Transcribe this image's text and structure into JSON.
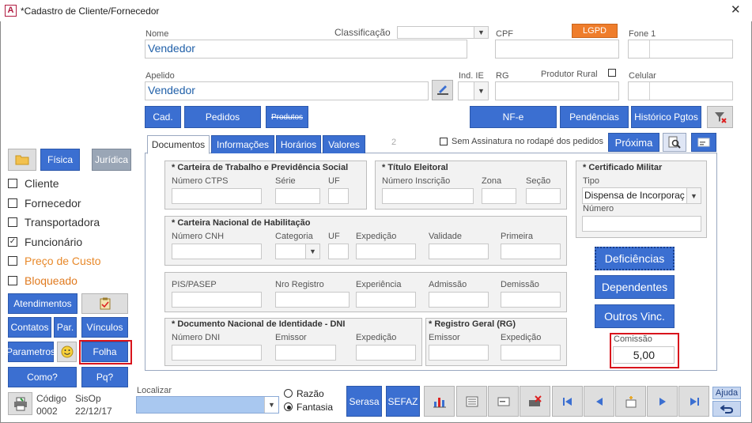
{
  "window": {
    "title": "*Cadastro de Cliente/Fornecedor",
    "app_letter": "A",
    "close": "✕"
  },
  "form": {
    "nome_label": "Nome",
    "nome_value": "Vendedor",
    "classificacao_label": "Classificação",
    "cpf_label": "CPF",
    "lgpd": "LGPD",
    "fone1_label": "Fone 1",
    "apelido_label": "Apelido",
    "apelido_value": "Vendedor",
    "ind_ie_label": "Ind. IE",
    "rg_label": "RG",
    "produtor_rural_label": "Produtor Rural",
    "celular_label": "Celular"
  },
  "action_buttons": {
    "cad": "Cad.",
    "pedidos": "Pedidos",
    "produtos": "Produtos",
    "nfe": "NF-e",
    "pendencias": "Pendências",
    "historico": "Histórico Pgtos"
  },
  "tabs": {
    "items": [
      "Documentos",
      "Informações",
      "Horários",
      "Valores"
    ],
    "counter": "2",
    "sem_assinatura": "Sem Assinatura no rodapé dos pedidos",
    "proxima": "Próxima"
  },
  "sidebar": {
    "fisica": "Física",
    "juridica": "Jurídica",
    "options": [
      {
        "label": "Cliente",
        "checked": false,
        "color": "#333333"
      },
      {
        "label": "Fornecedor",
        "checked": false,
        "color": "#333333"
      },
      {
        "label": "Transportadora",
        "checked": false,
        "color": "#333333"
      },
      {
        "label": "Funcionário",
        "checked": true,
        "color": "#333333"
      },
      {
        "label": "Preço de Custo",
        "checked": false,
        "color": "#e8892a"
      },
      {
        "label": "Bloqueado",
        "checked": false,
        "color": "#e07a1f"
      }
    ],
    "atendimentos": "Atendimentos",
    "contatos": "Contatos",
    "par": "Par.",
    "vinculos": "Vínculos",
    "parametros": "Parametros",
    "folha": "Folha",
    "como": "Como?",
    "pq": "Pq?",
    "codigo_label": "Código",
    "codigo_value": "0002",
    "sisop_label": "SisOp",
    "sisop_date": "22/12/17"
  },
  "documents": {
    "ctps": {
      "title": "* Carteira de Trabalho e Previdência Social",
      "numero": "Número CTPS",
      "serie": "Série",
      "uf": "UF"
    },
    "titulo": {
      "title": "* Título Eleitoral",
      "numero": "Número Inscrição",
      "zona": "Zona",
      "secao": "Seção"
    },
    "militar": {
      "title": "* Certificado Militar",
      "tipo": "Tipo",
      "tipo_value": "Dispensa de Incorporaç",
      "numero": "Número"
    },
    "cnh": {
      "title": "* Carteira Nacional de Habilitação",
      "numero": "Número CNH",
      "categoria": "Categoria",
      "uf": "UF",
      "expedicao": "Expedição",
      "validade": "Validade",
      "primeira": "Primeira"
    },
    "pis": {
      "pis": "PIS/PASEP",
      "nro": "Nro Registro",
      "experiencia": "Experiência",
      "admissao": "Admissão",
      "demissao": "Demissão"
    },
    "dni": {
      "title": "* Documento Nacional de Identidade - DNI",
      "numero": "Número DNI",
      "emissor": "Emissor",
      "expedicao": "Expedição"
    },
    "rg": {
      "title": "* Registro Geral (RG)",
      "emissor": "Emissor",
      "expedicao": "Expedição"
    },
    "deficiencias": "Deficiências",
    "dependentes": "Dependentes",
    "outros_vinc": "Outros Vinc.",
    "comissao_label": "Comissão",
    "comissao_value": "5,00"
  },
  "bottom": {
    "localizar": "Localizar",
    "razao": "Razão",
    "fantasia": "Fantasia",
    "serasa": "Serasa",
    "sefaz": "SEFAZ",
    "ajuda": "Ajuda"
  }
}
